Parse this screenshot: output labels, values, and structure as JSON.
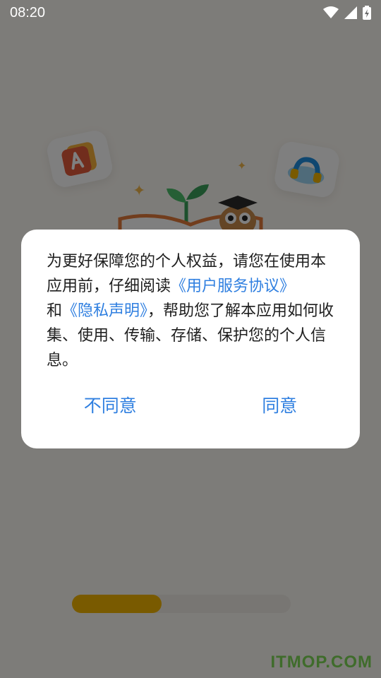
{
  "status_bar": {
    "time": "08:20"
  },
  "dialog": {
    "text_before": "为更好保障您的个人权益，请您在使用本应用前，仔细阅读",
    "user_agreement_link": "《用户服务协议》",
    "text_and": "和",
    "privacy_link": "《隐私声明》",
    "text_after": "，帮助您了解本应用如何收集、使用、传输、存储、保护您的个人信息。",
    "disagree_label": "不同意",
    "agree_label": "同意"
  },
  "splash": {
    "progress_fraction": 0.41
  },
  "watermark": "ITMOP.COM",
  "colors": {
    "accent_blue": "#2f7fe0",
    "progress_yellow": "#f3b400",
    "overlay": "rgba(0,0,0,0.5)",
    "watermark_green": "#7ed957"
  },
  "icons": [
    "wifi-icon",
    "cellular-signal-icon",
    "battery-charging-icon",
    "pdf-app-icon",
    "headphones-app-icon",
    "sparkle-icon",
    "sprout-icon",
    "owl-mascot-icon",
    "open-book-icon"
  ]
}
